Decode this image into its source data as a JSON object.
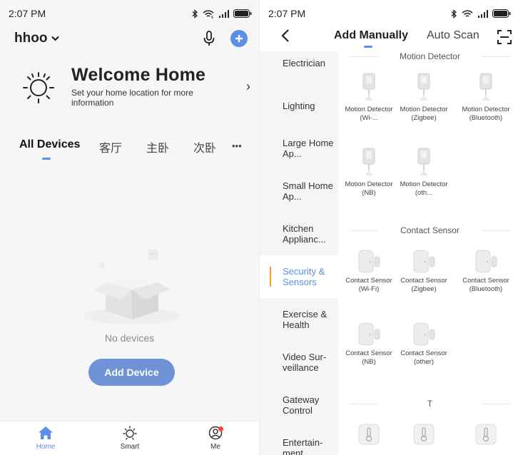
{
  "left": {
    "status": {
      "time": "2:07 PM"
    },
    "home_name": "hhoo",
    "welcome": {
      "title": "Welcome Home",
      "subtitle": "Set your home location for more information"
    },
    "rooms": [
      "All Devices",
      "客厅",
      "主卧",
      "次卧"
    ],
    "more_label": "•••",
    "empty_text": "No devices",
    "add_device_label": "Add Device",
    "bottom_nav": [
      {
        "label": "Home",
        "icon": "home-icon",
        "active": true
      },
      {
        "label": "Smart",
        "icon": "sun-icon",
        "active": false
      },
      {
        "label": "Me",
        "icon": "user-icon",
        "active": false
      }
    ]
  },
  "right": {
    "status": {
      "time": "2:07 PM"
    },
    "tabs": {
      "manual": "Add Manually",
      "auto": "Auto Scan"
    },
    "categories": [
      "Electrician",
      "Lighting",
      "Large Home Ap...",
      "Small Home Ap...",
      "Kitchen Applianc...",
      "Security & Sensors",
      "Exercise & Health",
      "Video Sur-veillance",
      "Gateway Control",
      "Entertain-ment"
    ],
    "active_category": "Security & Sensors",
    "sections": {
      "motion": {
        "title": "Motion Detector",
        "devices": [
          "Motion Detector (Wi-...",
          "Motion Detector (Zigbee)",
          "Motion Detector (Bluetooth)",
          "Motion Detector (NB)",
          "Motion Detector (oth..."
        ]
      },
      "contact": {
        "title": "Contact Sensor",
        "devices": [
          "Contact Sensor (Wi-Fi)",
          "Contact Sensor (Zigbee)",
          "Contact Sensor (Bluetooth)",
          "Contact Sensor (NB)",
          "Contact Sensor (other)"
        ]
      },
      "t": {
        "title": "T"
      }
    }
  },
  "colors": {
    "accent": "#5b8fe6",
    "button": "#6f93d6",
    "active_marker": "#f29b3a",
    "badge": "#f04a3a"
  }
}
